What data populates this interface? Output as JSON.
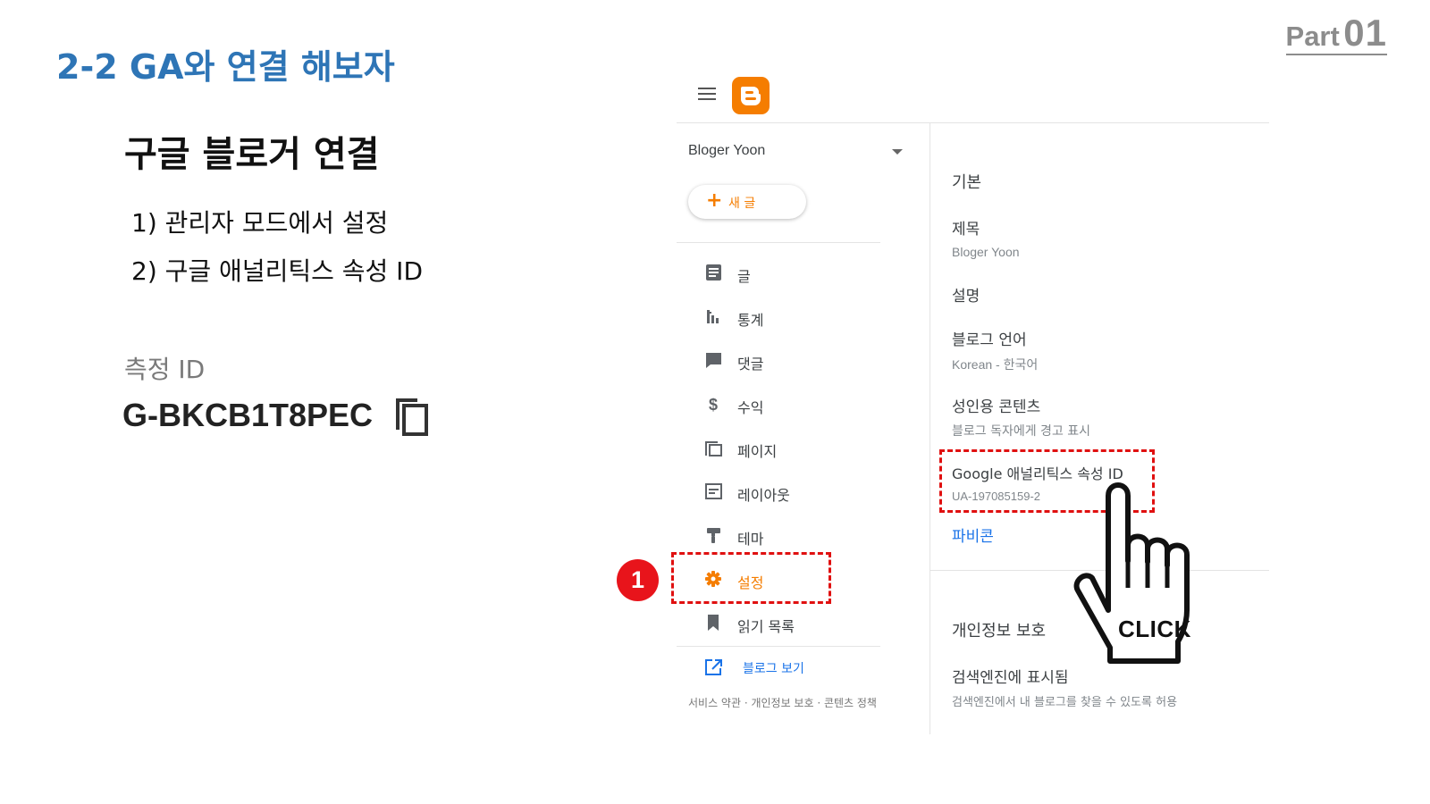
{
  "slide": {
    "part_label": "Part",
    "part_number": "01",
    "title": "2-2 GA와 연결 해보자",
    "heading": "구글 블로거 연결",
    "steps": [
      "1) 관리자 모드에서 설정",
      "2) 구글 애널리틱스 속성 ID"
    ],
    "measurement_id_label": "측정 ID",
    "measurement_id_value": "G-BKCB1T8PEC"
  },
  "blogger": {
    "blog_name": "Bloger Yoon",
    "new_post_label": "새 글",
    "nav": [
      {
        "label": "글",
        "icon": "posts-icon"
      },
      {
        "label": "통계",
        "icon": "stats-icon"
      },
      {
        "label": "댓글",
        "icon": "comments-icon"
      },
      {
        "label": "수익",
        "icon": "earnings-icon"
      },
      {
        "label": "페이지",
        "icon": "pages-icon"
      },
      {
        "label": "레이아웃",
        "icon": "layout-icon"
      },
      {
        "label": "테마",
        "icon": "theme-icon"
      },
      {
        "label": "설정",
        "icon": "settings-icon"
      },
      {
        "label": "읽기 목록",
        "icon": "reading-list-icon"
      }
    ],
    "view_blog_label": "블로그 보기",
    "footer": "서비스 약관 · 개인정보 보호 · 콘텐츠 정책",
    "settings": {
      "section_basic": "기본",
      "title_label": "제목",
      "title_value": "Bloger Yoon",
      "description_label": "설명",
      "language_label": "블로그 언어",
      "language_value": "Korean - 한국어",
      "adult_label": "성인용 콘텐츠",
      "adult_value": "블로그 독자에게 경고 표시",
      "ga_label": "Google 애널리틱스 속성 ID",
      "ga_value": "UA-197085159-2",
      "favicon_label": "파비콘",
      "section_privacy": "개인정보 보호",
      "search_label": "검색엔진에 표시됨",
      "search_value": "검색엔진에서 내 블로그를 찾을 수 있도록 허용"
    }
  },
  "annotations": {
    "step_badge": "1",
    "click_label": "CLICK"
  },
  "colors": {
    "title_blue": "#2e75b6",
    "blogger_orange": "#f57d00",
    "highlight_red": "#e01010",
    "link_blue": "#1a73e8"
  }
}
